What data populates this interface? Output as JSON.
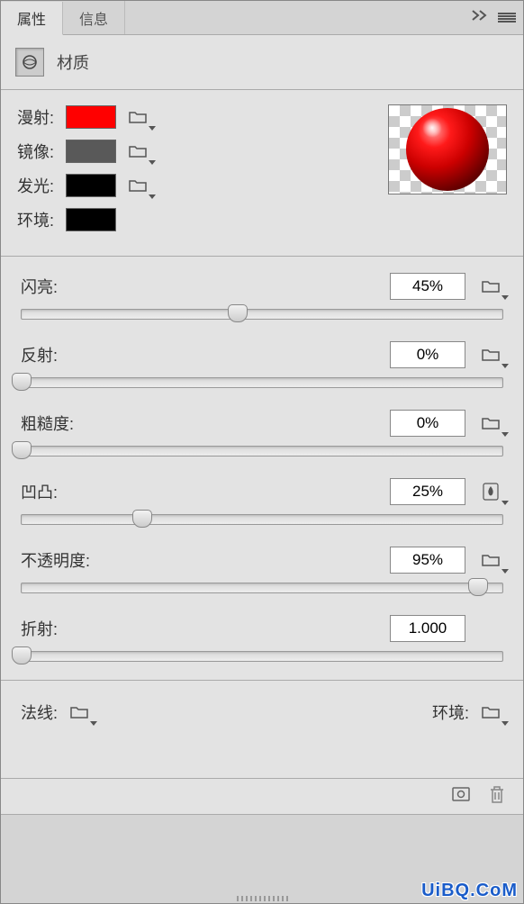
{
  "tabs": {
    "properties": "属性",
    "info": "信息"
  },
  "header": {
    "title": "材质"
  },
  "swatches": {
    "diffuse": {
      "label": "漫射:",
      "color": "#ff0000"
    },
    "specular": {
      "label": "镜像:",
      "color": "#595959"
    },
    "glow": {
      "label": "发光:",
      "color": "#000000"
    },
    "ambient": {
      "label": "环境:",
      "color": "#000000"
    }
  },
  "sliders": {
    "shine": {
      "label": "闪亮:",
      "value": "45%",
      "pos": 45
    },
    "reflection": {
      "label": "反射:",
      "value": "0%",
      "pos": 0
    },
    "roughness": {
      "label": "粗糙度:",
      "value": "0%",
      "pos": 0
    },
    "bump": {
      "label": "凹凸:",
      "value": "25%",
      "pos": 25
    },
    "opacity": {
      "label": "不透明度:",
      "value": "95%",
      "pos": 95
    },
    "refraction": {
      "label": "折射:",
      "value": "1.000",
      "pos": 0
    }
  },
  "bottom": {
    "normals": "法线:",
    "environment": "环境:"
  },
  "watermark": "UiBQ.CoM"
}
